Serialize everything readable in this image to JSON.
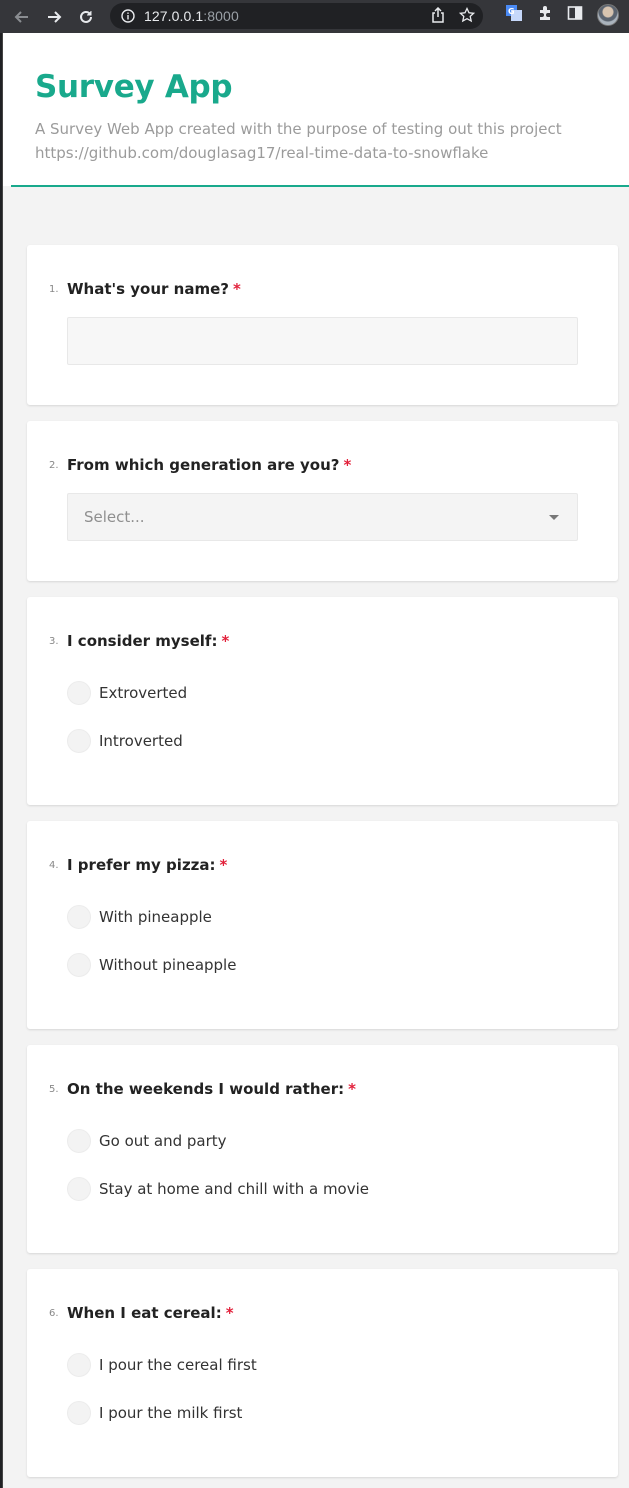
{
  "browser": {
    "url_host": "127.0.0.1",
    "url_port": ":8000",
    "icons": [
      "back-icon",
      "forward-icon",
      "reload-icon",
      "info-icon",
      "share-icon",
      "bookmark-star-icon",
      "translate-icon",
      "extensions-icon",
      "sidebar-icon",
      "profile-avatar"
    ]
  },
  "header": {
    "title": "Survey App",
    "description": "A Survey Web App created with the purpose of testing out this project https://github.com/douglasag17/real-time-data-to-snowflake"
  },
  "colors": {
    "accent": "#19a98c",
    "required": "#e2213b"
  },
  "questions": [
    {
      "number": "1.",
      "text": "What's your name?",
      "required_mark": "*",
      "type": "text",
      "value": ""
    },
    {
      "number": "2.",
      "text": "From which generation are you?",
      "required_mark": "*",
      "type": "select",
      "placeholder": "Select..."
    },
    {
      "number": "3.",
      "text": "I consider myself:",
      "required_mark": "*",
      "type": "radio",
      "options": [
        "Extroverted",
        "Introverted"
      ]
    },
    {
      "number": "4.",
      "text": "I prefer my pizza:",
      "required_mark": "*",
      "type": "radio",
      "options": [
        "With pineapple",
        "Without pineapple"
      ]
    },
    {
      "number": "5.",
      "text": "On the weekends I would rather:",
      "required_mark": "*",
      "type": "radio",
      "options": [
        "Go out and party",
        "Stay at home and chill with a movie"
      ]
    },
    {
      "number": "6.",
      "text": "When I eat cereal:",
      "required_mark": "*",
      "type": "radio",
      "options": [
        "I pour the cereal first",
        "I pour the milk first"
      ]
    }
  ]
}
